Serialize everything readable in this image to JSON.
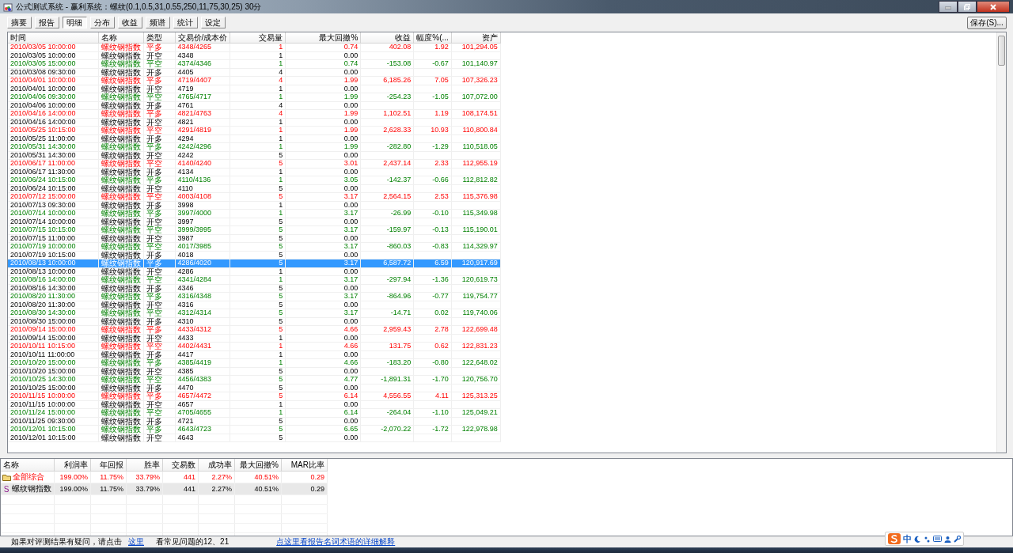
{
  "window": {
    "title": "公式测试系统 - 赢利系统：螺纹(0.1,0.5,31,0.55,250,11,75,30,25) 30分"
  },
  "tabs": [
    {
      "label": "摘要",
      "selected": false
    },
    {
      "label": "报告",
      "selected": false
    },
    {
      "label": "明细",
      "selected": true
    },
    {
      "label": "分布",
      "selected": false
    },
    {
      "label": "收益",
      "selected": false
    },
    {
      "label": "频谱",
      "selected": false
    },
    {
      "label": "统计",
      "selected": false
    },
    {
      "label": "设定",
      "selected": false
    }
  ],
  "save_button": "保存(S)...",
  "table": {
    "columns": [
      "时间",
      "名称",
      "类型",
      "交易价/成本价",
      "交易量",
      "最大回撤%",
      "收益",
      "幅度%(...",
      "资产"
    ],
    "rows": [
      {
        "kind": "profit",
        "time": "2010/03/05 10:00:00",
        "name": "螺纹钢指数",
        "type": "平多",
        "price": "4348/4265",
        "volume": "1",
        "drawdown": "0.74",
        "profit": "402.08",
        "range": "1.92",
        "assets": "101,294.05",
        "selected": false
      },
      {
        "kind": "open",
        "time": "2010/03/05 10:00:00",
        "name": "螺纹钢指数",
        "type": "开空",
        "price": "4348",
        "volume": "1",
        "drawdown": "0.00",
        "selected": false
      },
      {
        "kind": "loss",
        "time": "2010/03/05 15:00:00",
        "name": "螺纹钢指数",
        "type": "平空",
        "price": "4374/4346",
        "volume": "1",
        "drawdown": "0.74",
        "profit": "-153.08",
        "range": "-0.67",
        "assets": "101,140.97",
        "selected": false
      },
      {
        "kind": "open",
        "time": "2010/03/08 09:30:00",
        "name": "螺纹钢指数",
        "type": "开多",
        "price": "4405",
        "volume": "4",
        "drawdown": "0.00",
        "selected": false
      },
      {
        "kind": "profit",
        "time": "2010/04/01 10:00:00",
        "name": "螺纹钢指数",
        "type": "平多",
        "price": "4719/4407",
        "volume": "4",
        "drawdown": "1.99",
        "profit": "6,185.26",
        "range": "7.05",
        "assets": "107,326.23",
        "selected": false
      },
      {
        "kind": "open",
        "time": "2010/04/01 10:00:00",
        "name": "螺纹钢指数",
        "type": "开空",
        "price": "4719",
        "volume": "1",
        "drawdown": "0.00",
        "selected": false
      },
      {
        "kind": "loss",
        "time": "2010/04/06 09:30:00",
        "name": "螺纹钢指数",
        "type": "平空",
        "price": "4765/4717",
        "volume": "1",
        "drawdown": "1.99",
        "profit": "-254.23",
        "range": "-1.05",
        "assets": "107,072.00",
        "selected": false
      },
      {
        "kind": "open",
        "time": "2010/04/06 10:00:00",
        "name": "螺纹钢指数",
        "type": "开多",
        "price": "4761",
        "volume": "4",
        "drawdown": "0.00",
        "selected": false
      },
      {
        "kind": "profit",
        "time": "2010/04/16 14:00:00",
        "name": "螺纹钢指数",
        "type": "平多",
        "price": "4821/4763",
        "volume": "4",
        "drawdown": "1.99",
        "profit": "1,102.51",
        "range": "1.19",
        "assets": "108,174.51",
        "selected": false
      },
      {
        "kind": "open",
        "time": "2010/04/16 14:00:00",
        "name": "螺纹钢指数",
        "type": "开空",
        "price": "4821",
        "volume": "1",
        "drawdown": "0.00",
        "selected": false
      },
      {
        "kind": "profit",
        "time": "2010/05/25 10:15:00",
        "name": "螺纹钢指数",
        "type": "平空",
        "price": "4291/4819",
        "volume": "1",
        "drawdown": "1.99",
        "profit": "2,628.33",
        "range": "10.93",
        "assets": "110,800.84",
        "selected": false
      },
      {
        "kind": "open",
        "time": "2010/05/25 11:00:00",
        "name": "螺纹钢指数",
        "type": "开多",
        "price": "4294",
        "volume": "1",
        "drawdown": "0.00",
        "selected": false
      },
      {
        "kind": "loss",
        "time": "2010/05/31 14:30:00",
        "name": "螺纹钢指数",
        "type": "平多",
        "price": "4242/4296",
        "volume": "1",
        "drawdown": "1.99",
        "profit": "-282.80",
        "range": "-1.29",
        "assets": "110,518.05",
        "selected": false
      },
      {
        "kind": "open",
        "time": "2010/05/31 14:30:00",
        "name": "螺纹钢指数",
        "type": "开空",
        "price": "4242",
        "volume": "5",
        "drawdown": "0.00",
        "selected": false
      },
      {
        "kind": "profit",
        "time": "2010/06/17 11:00:00",
        "name": "螺纹钢指数",
        "type": "平空",
        "price": "4140/4240",
        "volume": "5",
        "drawdown": "3.01",
        "profit": "2,437.14",
        "range": "2.33",
        "assets": "112,955.19",
        "selected": false
      },
      {
        "kind": "open",
        "time": "2010/06/17 11:30:00",
        "name": "螺纹钢指数",
        "type": "开多",
        "price": "4134",
        "volume": "1",
        "drawdown": "0.00",
        "selected": false
      },
      {
        "kind": "loss",
        "time": "2010/06/24 10:15:00",
        "name": "螺纹钢指数",
        "type": "平多",
        "price": "4110/4136",
        "volume": "1",
        "drawdown": "3.05",
        "profit": "-142.37",
        "range": "-0.66",
        "assets": "112,812.82",
        "selected": false
      },
      {
        "kind": "open",
        "time": "2010/06/24 10:15:00",
        "name": "螺纹钢指数",
        "type": "开空",
        "price": "4110",
        "volume": "5",
        "drawdown": "0.00",
        "selected": false
      },
      {
        "kind": "profit",
        "time": "2010/07/12 15:00:00",
        "name": "螺纹钢指数",
        "type": "平空",
        "price": "4003/4108",
        "volume": "5",
        "drawdown": "3.17",
        "profit": "2,564.15",
        "range": "2.53",
        "assets": "115,376.98",
        "selected": false
      },
      {
        "kind": "open",
        "time": "2010/07/13 09:30:00",
        "name": "螺纹钢指数",
        "type": "开多",
        "price": "3998",
        "volume": "1",
        "drawdown": "0.00",
        "selected": false
      },
      {
        "kind": "loss",
        "time": "2010/07/14 10:00:00",
        "name": "螺纹钢指数",
        "type": "平多",
        "price": "3997/4000",
        "volume": "1",
        "drawdown": "3.17",
        "profit": "-26.99",
        "range": "-0.10",
        "assets": "115,349.98",
        "selected": false
      },
      {
        "kind": "open",
        "time": "2010/07/14 10:00:00",
        "name": "螺纹钢指数",
        "type": "开空",
        "price": "3997",
        "volume": "5",
        "drawdown": "0.00",
        "selected": false
      },
      {
        "kind": "loss",
        "time": "2010/07/15 10:15:00",
        "name": "螺纹钢指数",
        "type": "平空",
        "price": "3999/3995",
        "volume": "5",
        "drawdown": "3.17",
        "profit": "-159.97",
        "range": "-0.13",
        "assets": "115,190.01",
        "selected": false
      },
      {
        "kind": "open",
        "time": "2010/07/15 11:00:00",
        "name": "螺纹钢指数",
        "type": "开空",
        "price": "3987",
        "volume": "5",
        "drawdown": "0.00",
        "selected": false
      },
      {
        "kind": "loss",
        "time": "2010/07/19 10:00:00",
        "name": "螺纹钢指数",
        "type": "平空",
        "price": "4017/3985",
        "volume": "5",
        "drawdown": "3.17",
        "profit": "-860.03",
        "range": "-0.83",
        "assets": "114,329.97",
        "selected": false
      },
      {
        "kind": "open",
        "time": "2010/07/19 10:15:00",
        "name": "螺纹钢指数",
        "type": "开多",
        "price": "4018",
        "volume": "5",
        "drawdown": "0.00",
        "selected": false
      },
      {
        "kind": "profit",
        "time": "2010/08/13 10:00:00",
        "name": "螺纹钢指数",
        "type": "平多",
        "price": "4286/4020",
        "volume": "5",
        "drawdown": "3.17",
        "profit": "6,587.72",
        "range": "6.59",
        "assets": "120,917.69",
        "selected": true
      },
      {
        "kind": "open",
        "time": "2010/08/13 10:00:00",
        "name": "螺纹钢指数",
        "type": "开空",
        "price": "4286",
        "volume": "1",
        "drawdown": "0.00",
        "selected": false
      },
      {
        "kind": "loss",
        "time": "2010/08/16 14:00:00",
        "name": "螺纹钢指数",
        "type": "平空",
        "price": "4341/4284",
        "volume": "1",
        "drawdown": "3.17",
        "profit": "-297.94",
        "range": "-1.36",
        "assets": "120,619.73",
        "selected": false
      },
      {
        "kind": "open",
        "time": "2010/08/16 14:30:00",
        "name": "螺纹钢指数",
        "type": "开多",
        "price": "4346",
        "volume": "5",
        "drawdown": "0.00",
        "selected": false
      },
      {
        "kind": "loss",
        "time": "2010/08/20 11:30:00",
        "name": "螺纹钢指数",
        "type": "平多",
        "price": "4316/4348",
        "volume": "5",
        "drawdown": "3.17",
        "profit": "-864.96",
        "range": "-0.77",
        "assets": "119,754.77",
        "selected": false
      },
      {
        "kind": "open",
        "time": "2010/08/20 11:30:00",
        "name": "螺纹钢指数",
        "type": "开空",
        "price": "4316",
        "volume": "5",
        "drawdown": "0.00",
        "selected": false
      },
      {
        "kind": "loss",
        "time": "2010/08/30 14:30:00",
        "name": "螺纹钢指数",
        "type": "平空",
        "price": "4312/4314",
        "volume": "5",
        "drawdown": "3.17",
        "profit": "-14.71",
        "range": "0.02",
        "assets": "119,740.06",
        "selected": false
      },
      {
        "kind": "open",
        "time": "2010/08/30 15:00:00",
        "name": "螺纹钢指数",
        "type": "开多",
        "price": "4310",
        "volume": "5",
        "drawdown": "0.00",
        "selected": false
      },
      {
        "kind": "profit",
        "time": "2010/09/14 15:00:00",
        "name": "螺纹钢指数",
        "type": "平多",
        "price": "4433/4312",
        "volume": "5",
        "drawdown": "4.66",
        "profit": "2,959.43",
        "range": "2.78",
        "assets": "122,699.48",
        "selected": false
      },
      {
        "kind": "open",
        "time": "2010/09/14 15:00:00",
        "name": "螺纹钢指数",
        "type": "开空",
        "price": "4433",
        "volume": "1",
        "drawdown": "0.00",
        "selected": false
      },
      {
        "kind": "profit",
        "time": "2010/10/11 10:15:00",
        "name": "螺纹钢指数",
        "type": "平空",
        "price": "4402/4431",
        "volume": "1",
        "drawdown": "4.66",
        "profit": "131.75",
        "range": "0.62",
        "assets": "122,831.23",
        "selected": false
      },
      {
        "kind": "open",
        "time": "2010/10/11 11:00:00",
        "name": "螺纹钢指数",
        "type": "开多",
        "price": "4417",
        "volume": "1",
        "drawdown": "0.00",
        "selected": false
      },
      {
        "kind": "loss",
        "time": "2010/10/20 15:00:00",
        "name": "螺纹钢指数",
        "type": "平多",
        "price": "4385/4419",
        "volume": "1",
        "drawdown": "4.66",
        "profit": "-183.20",
        "range": "-0.80",
        "assets": "122,648.02",
        "selected": false
      },
      {
        "kind": "open",
        "time": "2010/10/20 15:00:00",
        "name": "螺纹钢指数",
        "type": "开空",
        "price": "4385",
        "volume": "5",
        "drawdown": "0.00",
        "selected": false
      },
      {
        "kind": "loss",
        "time": "2010/10/25 14:30:00",
        "name": "螺纹钢指数",
        "type": "平空",
        "price": "4456/4383",
        "volume": "5",
        "drawdown": "4.77",
        "profit": "-1,891.31",
        "range": "-1.70",
        "assets": "120,756.70",
        "selected": false
      },
      {
        "kind": "open",
        "time": "2010/10/25 15:00:00",
        "name": "螺纹钢指数",
        "type": "开多",
        "price": "4470",
        "volume": "5",
        "drawdown": "0.00",
        "selected": false
      },
      {
        "kind": "profit",
        "time": "2010/11/15 10:00:00",
        "name": "螺纹钢指数",
        "type": "平多",
        "price": "4657/4472",
        "volume": "5",
        "drawdown": "6.14",
        "profit": "4,556.55",
        "range": "4.11",
        "assets": "125,313.25",
        "selected": false
      },
      {
        "kind": "open",
        "time": "2010/11/15 10:00:00",
        "name": "螺纹钢指数",
        "type": "开空",
        "price": "4657",
        "volume": "1",
        "drawdown": "0.00",
        "selected": false
      },
      {
        "kind": "loss",
        "time": "2010/11/24 15:00:00",
        "name": "螺纹钢指数",
        "type": "平空",
        "price": "4705/4655",
        "volume": "1",
        "drawdown": "6.14",
        "profit": "-264.04",
        "range": "-1.10",
        "assets": "125,049.21",
        "selected": false
      },
      {
        "kind": "open",
        "time": "2010/11/25 09:30:00",
        "name": "螺纹钢指数",
        "type": "开多",
        "price": "4721",
        "volume": "5",
        "drawdown": "0.00",
        "selected": false
      },
      {
        "kind": "loss",
        "time": "2010/12/01 10:15:00",
        "name": "螺纹钢指数",
        "type": "平多",
        "price": "4643/4723",
        "volume": "5",
        "drawdown": "6.65",
        "profit": "-2,070.22",
        "range": "-1.72",
        "assets": "122,978.98",
        "selected": false
      },
      {
        "kind": "open",
        "time": "2010/12/01 10:15:00",
        "name": "螺纹钢指数",
        "type": "开空",
        "price": "4643",
        "volume": "5",
        "drawdown": "0.00",
        "selected": false
      }
    ]
  },
  "summary": {
    "columns": [
      "名称",
      "利润率",
      "年回报",
      "胜率",
      "交易数",
      "成功率",
      "最大回撤%",
      "MAR比率"
    ],
    "rows": [
      {
        "kind": "group",
        "cells": [
          "全部综合",
          "199.00%",
          "11.75%",
          "33.79%",
          "441",
          "2.27%",
          "40.51%",
          "0.29"
        ],
        "selected": false
      },
      {
        "kind": "series",
        "marker": "S",
        "cells": [
          "螺纹钢指数",
          "199.00%",
          "11.75%",
          "33.79%",
          "441",
          "2.27%",
          "40.51%",
          "0.29"
        ],
        "selected": true
      }
    ]
  },
  "status": {
    "text": "如果对评测结果有疑问，请点击",
    "link": "这里",
    "text_2": "看常见问题的12、21",
    "link_2": "点这里看报告名词术语的详细解释"
  },
  "ime": {
    "label": "中"
  }
}
